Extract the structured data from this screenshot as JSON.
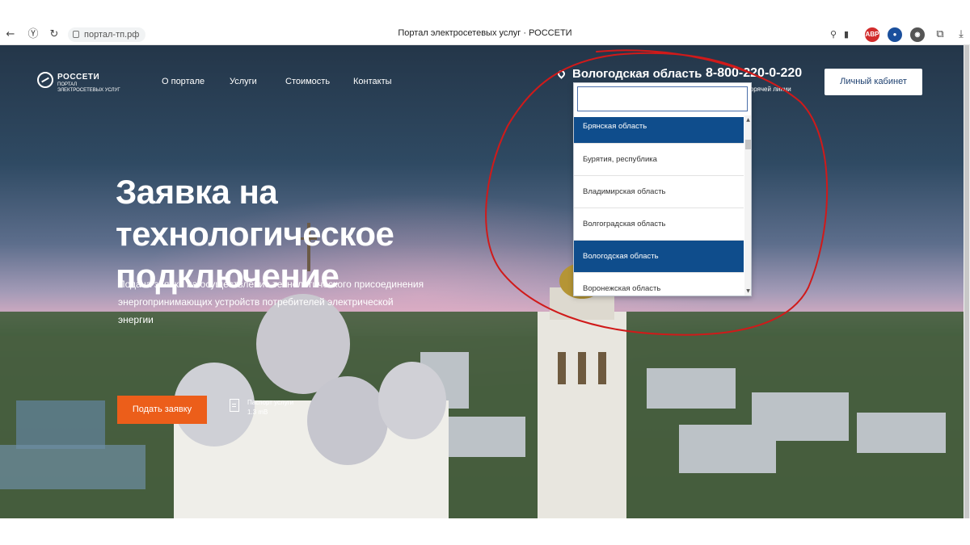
{
  "browser": {
    "url": "портал-тп.рф",
    "tab_title": "Портал электросетевых услуг · РОССЕТИ",
    "back_icon": "arrow-left-icon",
    "extensions": [
      {
        "label": "ABP",
        "color": "#d22c2c"
      }
    ]
  },
  "header": {
    "logo_title": "РОССЕТИ",
    "logo_sub_1": "ПОРТАЛ",
    "logo_sub_2": "ЭЛЕКТРОСЕТЕВЫХ УСЛУГ",
    "menu": [
      "О портале",
      "Услуги",
      "Стоимость",
      "Контакты"
    ],
    "region": "Вологодская область",
    "phone": "8-800-220-0-220",
    "phone_note": "горячей линии",
    "cabinet_button": "Личный кабинет"
  },
  "hero": {
    "title_line1": "Заявка на технологическое",
    "title_line2": "подключение",
    "desc_line1": "Подача заявки на осуществление технологического присоединения",
    "desc_line2": "энергопринимающих устройств потребителей электрической энергии",
    "apply_button": "Подать заявку",
    "doc_label": "Паспорт услуги",
    "doc_size": "1.3 mB"
  },
  "dropdown": {
    "search_value": "",
    "items": [
      {
        "label": "Брянская область",
        "selected": true
      },
      {
        "label": "Бурятия, республика",
        "selected": false
      },
      {
        "label": "Владимирская область",
        "selected": false
      },
      {
        "label": "Волгоградская область",
        "selected": false
      },
      {
        "label": "Вологодская область",
        "selected": true
      },
      {
        "label": "Воронежская область",
        "selected": false
      }
    ]
  },
  "colors": {
    "accent_orange": "#ec5e1a",
    "selected_blue": "#0f4d8c",
    "annotation_red": "#d01a1a"
  }
}
